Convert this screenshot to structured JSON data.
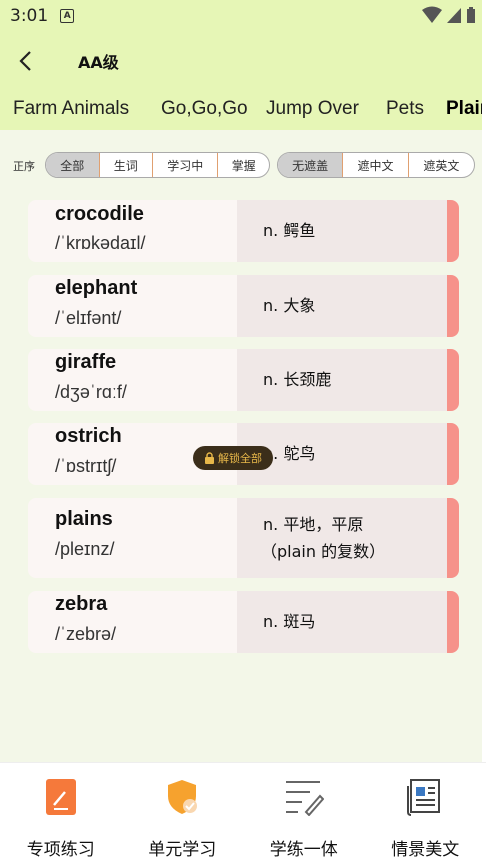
{
  "status": {
    "time": "3:01",
    "app_badge": "A"
  },
  "header": {
    "title": "AA级"
  },
  "tabs": [
    {
      "label": "Farm Animals"
    },
    {
      "label": "Go,Go,Go"
    },
    {
      "label": "Jump Over"
    },
    {
      "label": "Pets"
    },
    {
      "label": "Plains"
    }
  ],
  "filter": {
    "order_label": "正序",
    "group1": [
      "全部",
      "生词",
      "学习中",
      "掌握"
    ],
    "group2": [
      "无遮盖",
      "遮中文",
      "遮英文"
    ]
  },
  "words": [
    {
      "word": "crocodile",
      "phonetic": "/ˈkrɒkədaɪl/",
      "meaning": [
        "n. 鳄鱼"
      ]
    },
    {
      "word": "elephant",
      "phonetic": "/ˈelɪfənt/",
      "meaning": [
        "n. 大象"
      ]
    },
    {
      "word": "giraffe",
      "phonetic": "/dʒəˈrɑːf/",
      "meaning": [
        "n. 长颈鹿"
      ]
    },
    {
      "word": "ostrich",
      "phonetic": "/ˈɒstrɪtʃ/",
      "meaning": [
        "n. 鸵鸟"
      ]
    },
    {
      "word": "plains",
      "phonetic": "/pleɪnz/",
      "meaning": [
        "n. 平地，平原",
        "（plain 的复数）"
      ]
    },
    {
      "word": "zebra",
      "phonetic": "/ˈzebrə/",
      "meaning": [
        "n. 斑马"
      ]
    }
  ],
  "unlock": {
    "label": "解锁全部"
  },
  "bottom_nav": [
    {
      "label": "专项练习",
      "icon": "practice-icon"
    },
    {
      "label": "单元学习",
      "icon": "shield-check-icon"
    },
    {
      "label": "学练一体",
      "icon": "edit-list-icon"
    },
    {
      "label": "情景美文",
      "icon": "newspaper-icon"
    }
  ],
  "colors": {
    "header_bg": "#e6f6b6",
    "accent_stripe": "#f6928a",
    "nav_orange": "#f5793b"
  }
}
